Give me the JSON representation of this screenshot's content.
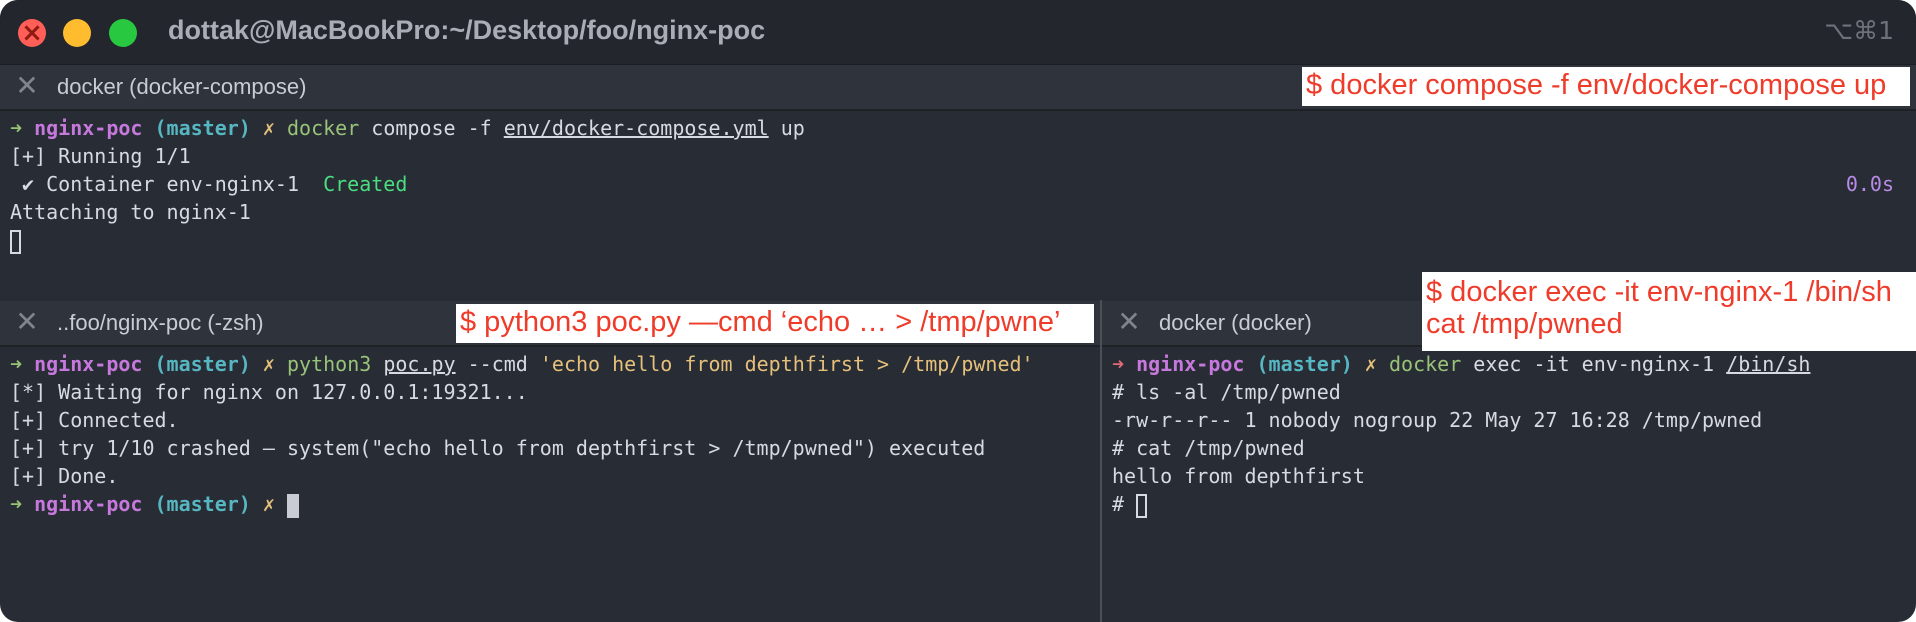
{
  "window": {
    "title": "dottak@MacBookPro:~/Desktop/foo/nginx-poc",
    "shortcut": "⌥⌘1"
  },
  "panes": {
    "top": {
      "tab_title": "docker (docker-compose)",
      "annotation": "$ docker compose -f env/docker-compose up",
      "prompt": {
        "arrow": "➜",
        "repo": "nginx-poc",
        "branch": "(master)",
        "dirty": "✗"
      },
      "command": {
        "program": "docker",
        "args_before": "compose -f",
        "file": "env/docker-compose.yml",
        "args_after": "up"
      },
      "lines": {
        "running": "[+] Running 1/1",
        "container": " ✔ Container env-nginx-1",
        "status": "Created",
        "timing": "0.0s",
        "attaching": "Attaching to nginx-1"
      }
    },
    "bottom_left": {
      "tab_title": "..foo/nginx-poc (-zsh)",
      "annotation": "$ python3 poc.py —cmd ‘echo … > /tmp/pwne’",
      "prompt": {
        "arrow": "➜",
        "repo": "nginx-poc",
        "branch": "(master)",
        "dirty": "✗"
      },
      "command": {
        "program": "python3",
        "script": "poc.py",
        "flag": "--cmd",
        "string": "'echo hello from depthfirst > /tmp/pwned'"
      },
      "lines": {
        "waiting": "[*] Waiting for nginx on 127.0.0.1:19321...",
        "connected": "[+] Connected.",
        "crashed": "[+] try 1/10 crashed — system(\"echo hello from depthfirst > /tmp/pwned\") executed",
        "done": "[+] Done."
      }
    },
    "bottom_right": {
      "tab_title": "docker (docker)",
      "annotation_line1": "$ docker exec -it env-nginx-1 /bin/sh",
      "annotation_line2": "cat /tmp/pwned",
      "prompt": {
        "arrow": "➜",
        "repo": "nginx-poc",
        "branch": "(master)",
        "dirty": "✗"
      },
      "command": {
        "program": "docker",
        "args": "exec -it env-nginx-1",
        "shell": "/bin/sh"
      },
      "lines": {
        "ls_cmd": "# ls -al /tmp/pwned",
        "ls_out": "-rw-r--r-- 1 nobody nogroup 22 May 27 16:28 /tmp/pwned",
        "cat_cmd": "# cat /tmp/pwned",
        "cat_out": "hello from depthfirst",
        "shell_prompt": "# "
      }
    }
  },
  "colors": {
    "background": "#282c34",
    "annotation_text": "#ef3b2a",
    "prompt_arrow": "#98c379",
    "repo": "#c678dd",
    "branch": "#56b6c2",
    "string": "#e5c07b"
  }
}
